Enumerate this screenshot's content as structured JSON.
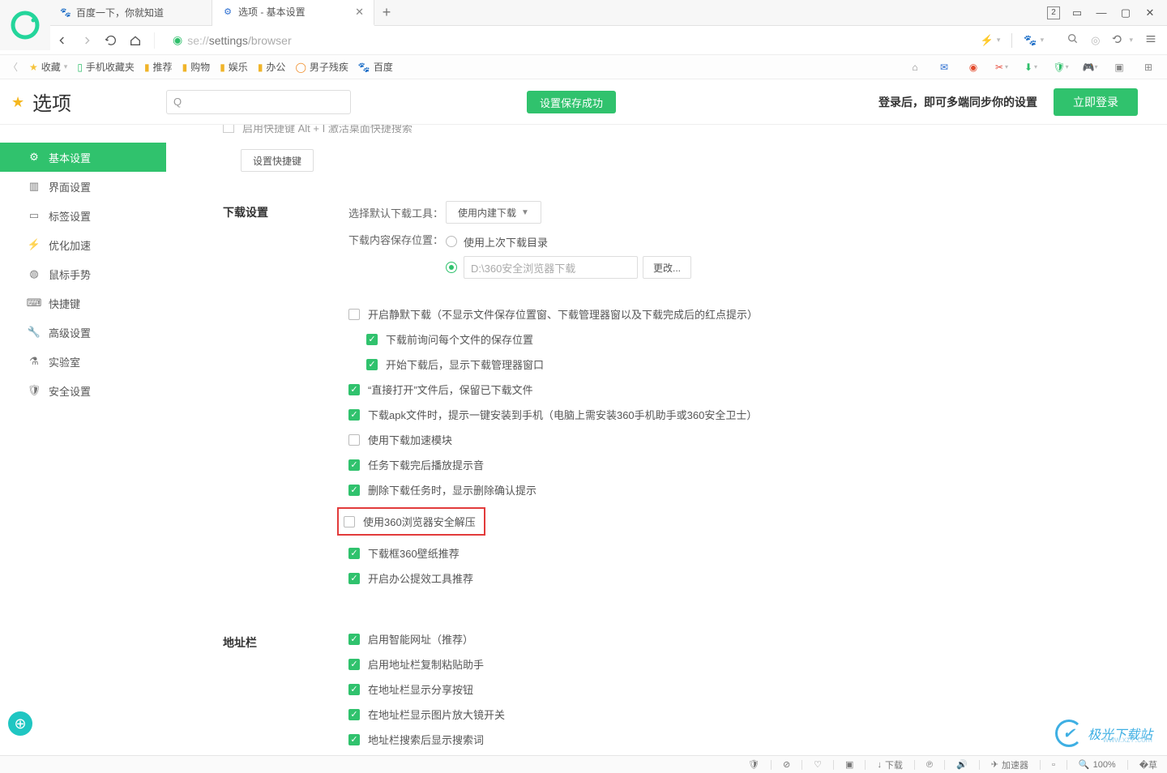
{
  "window": {
    "tab_count": "2"
  },
  "tabs": [
    {
      "favicon": "paw",
      "title": "百度一下，你就知道"
    },
    {
      "favicon": "gear",
      "title": "选项 - 基本设置"
    }
  ],
  "url": {
    "proto": "se://",
    "path1": "settings",
    "path2": "/browser"
  },
  "bookmarks": {
    "fav": "收藏",
    "mobile": "手机收藏夹",
    "items": [
      "推荐",
      "购物",
      "娱乐",
      "办公"
    ],
    "remnant": "男子残疾",
    "baidu": "百度"
  },
  "header": {
    "title": "选项",
    "search_icon": "Q",
    "save_ok": "设置保存成功",
    "login_hint": "登录后，即可多端同步你的设置",
    "login_btn": "立即登录"
  },
  "sidebar": {
    "items": [
      "基本设置",
      "界面设置",
      "标签设置",
      "优化加速",
      "鼠标手势",
      "快捷键",
      "高级设置",
      "实验室",
      "安全设置"
    ]
  },
  "partial": {
    "text": "启用快捷键  Alt + I   激活桌面快捷搜索",
    "btn": "设置快捷键"
  },
  "download": {
    "section_title": "下载设置",
    "tool_label": "选择默认下载工具：",
    "tool_value": "使用内建下载",
    "path_label": "下载内容保存位置：",
    "radio_last": "使用上次下载目录",
    "path_value": "D:\\360安全浏览器下载",
    "change": "更改...",
    "chks": [
      {
        "on": false,
        "text": "开启静默下载（不显示文件保存位置窗、下载管理器窗以及下载完成后的红点提示）"
      },
      {
        "on": true,
        "indent": true,
        "text": "下载前询问每个文件的保存位置"
      },
      {
        "on": true,
        "indent": true,
        "text": "开始下载后，显示下载管理器窗口"
      },
      {
        "on": true,
        "text": "“直接打开”文件后，保留已下载文件"
      },
      {
        "on": true,
        "text": "下载apk文件时，提示一键安装到手机（电脑上需安装360手机助手或360安全卫士）"
      },
      {
        "on": false,
        "text": "使用下载加速模块"
      },
      {
        "on": true,
        "text": "任务下载完后播放提示音"
      },
      {
        "on": true,
        "text": "删除下载任务时，显示删除确认提示"
      },
      {
        "on": false,
        "text": "使用360浏览器安全解压",
        "highlight": true
      },
      {
        "on": true,
        "text": "下载框360壁纸推荐"
      },
      {
        "on": true,
        "text": "开启办公提效工具推荐"
      }
    ]
  },
  "addressbar": {
    "section_title": "地址栏",
    "chks": [
      {
        "on": true,
        "text": "启用智能网址（推荐）"
      },
      {
        "on": true,
        "text": "启用地址栏复制粘贴助手"
      },
      {
        "on": true,
        "text": "在地址栏显示分享按钮"
      },
      {
        "on": true,
        "text": "在地址栏显示图片放大镜开关"
      },
      {
        "on": true,
        "text": "地址栏搜索后显示搜索词"
      }
    ]
  },
  "statusbar": {
    "percent": "100%",
    "dl": "下载",
    "acc": "加速器"
  },
  "watermark": {
    "name": "极光下载站",
    "sub": "www.xz7.com"
  }
}
